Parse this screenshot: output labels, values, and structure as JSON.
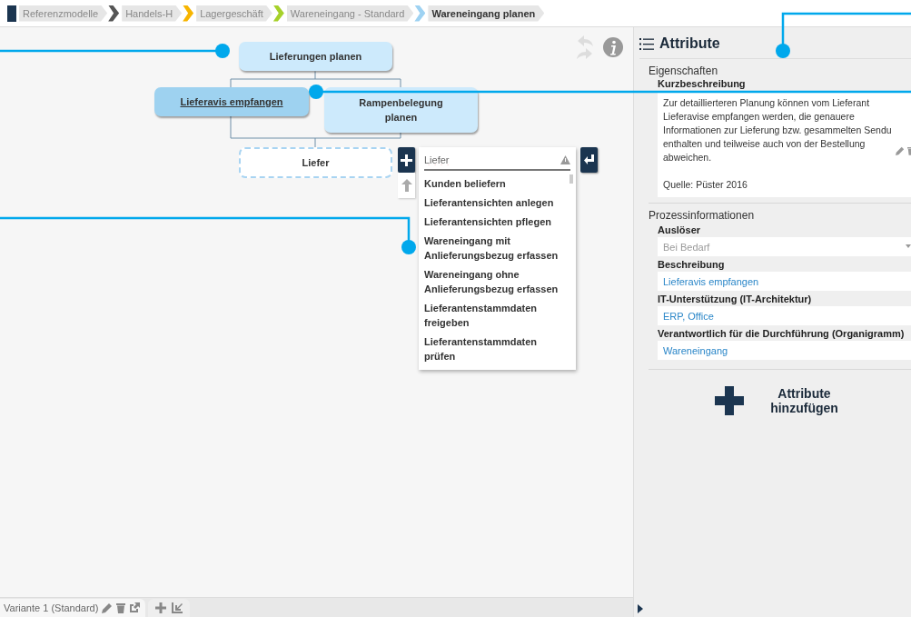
{
  "breadcrumbs": [
    {
      "label": "Referenzmodelle",
      "color": "#1b3550",
      "selected": false
    },
    {
      "label": "Handels-H",
      "color": "#555555",
      "selected": false
    },
    {
      "label": "Lagergeschäft",
      "color": "#f7b500",
      "selected": false
    },
    {
      "label": "Wareneingang - Standard",
      "color": "#a6d12a",
      "selected": false
    },
    {
      "label": "Wareneingang planen",
      "color": "#9ed2f2",
      "selected": true
    }
  ],
  "diagram": {
    "nodes": [
      {
        "label": "Lieferungen planen",
        "kind": "process",
        "selected": false
      },
      {
        "label": "Lieferavis empfangen",
        "kind": "process",
        "selected": true
      },
      {
        "label": "Rampenbelegung planen",
        "kind": "process",
        "selected": false
      },
      {
        "label": "Liefer",
        "kind": "draft",
        "selected": false
      }
    ],
    "autocomplete": {
      "value": "Liefer",
      "options": [
        "Kunden beliefern",
        "Lieferantensichten anlegen",
        "Lieferantensichten pflegen",
        "Wareneingang mit Anlieferungsbezug erfassen",
        "Wareneingang ohne Anlieferungsbezug erfassen",
        "Lieferantenstammdaten freigeben",
        "Lieferantenstammdaten prüfen"
      ]
    }
  },
  "variant_tab": {
    "label": "Variante 1 (Standard)"
  },
  "attributes": {
    "title": "Attribute",
    "properties": {
      "heading": "Eigenschaften",
      "label": "Kurzbeschreibung",
      "text": "Zur detaillierteren Planung können vom Lieferant Lieferavise empfangen werden, die genauere Informationen zur Lieferung bzw. gesammelten Sendu",
      "text2": "enthalten und teilweise auch von der Bestellung abweichen.",
      "source": "Quelle: Püster 2016"
    },
    "process": {
      "heading": "Prozessinformationen",
      "fields": [
        {
          "label": "Auslöser",
          "value": "Bei Bedarf",
          "kind": "select"
        },
        {
          "label": "Beschreibung",
          "value": "Lieferavis empfangen",
          "kind": "link"
        },
        {
          "label": "IT-Unterstützung (IT-Architektur)",
          "value": "ERP, Office",
          "kind": "link"
        },
        {
          "label": "Verantwortlich für die Durchführung (Organigramm)",
          "value": "Wareneingang",
          "kind": "link"
        }
      ]
    },
    "add_button": "Attribute hinzufügen"
  }
}
